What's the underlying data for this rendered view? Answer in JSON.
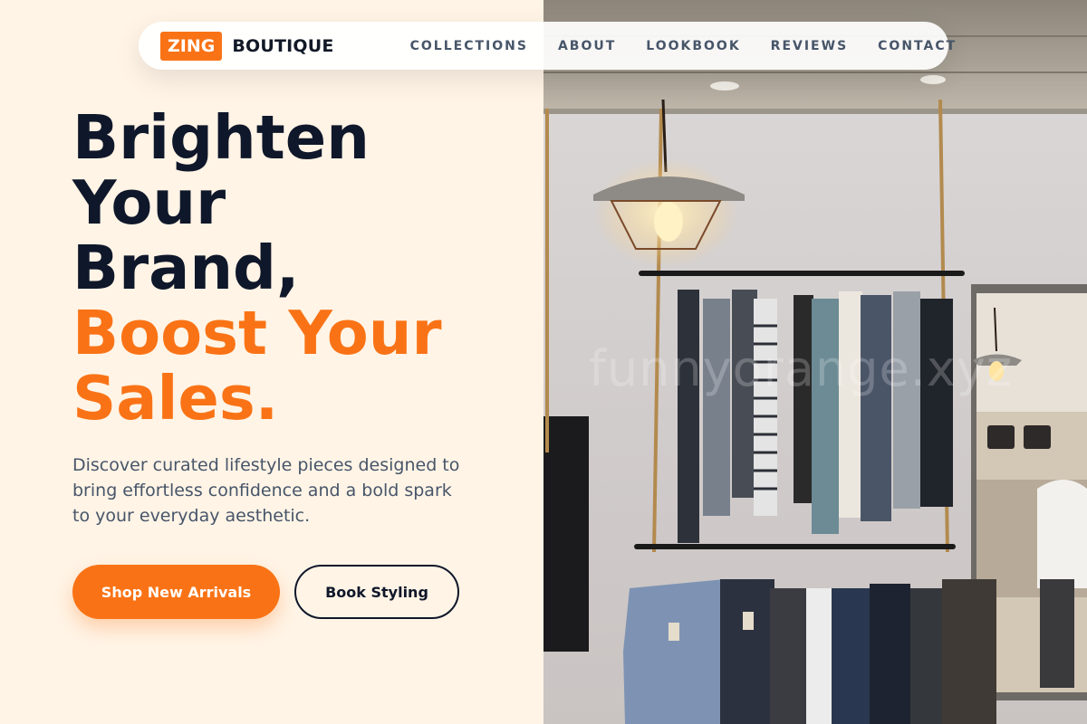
{
  "brand": {
    "badge": "ZING",
    "name": "BOUTIQUE"
  },
  "nav": {
    "items": [
      {
        "label": "COLLECTIONS"
      },
      {
        "label": "ABOUT"
      },
      {
        "label": "LOOKBOOK"
      },
      {
        "label": "REVIEWS"
      },
      {
        "label": "CONTACT"
      }
    ]
  },
  "hero": {
    "headline_line1": "Brighten",
    "headline_line2": "Your",
    "headline_line3": "Brand,",
    "headline_line4": "Boost Your",
    "headline_line5": "Sales.",
    "lede": "Discover curated lifestyle pieces designed to bring effortless confidence and a bold spark to your everyday aesthetic.",
    "primary_cta": "Shop New Arrivals",
    "secondary_cta": "Book Styling"
  },
  "watermark": "funnyorange.xyz",
  "colors": {
    "accent": "#f97316",
    "ink": "#0f172a",
    "background": "#fff4e6"
  }
}
